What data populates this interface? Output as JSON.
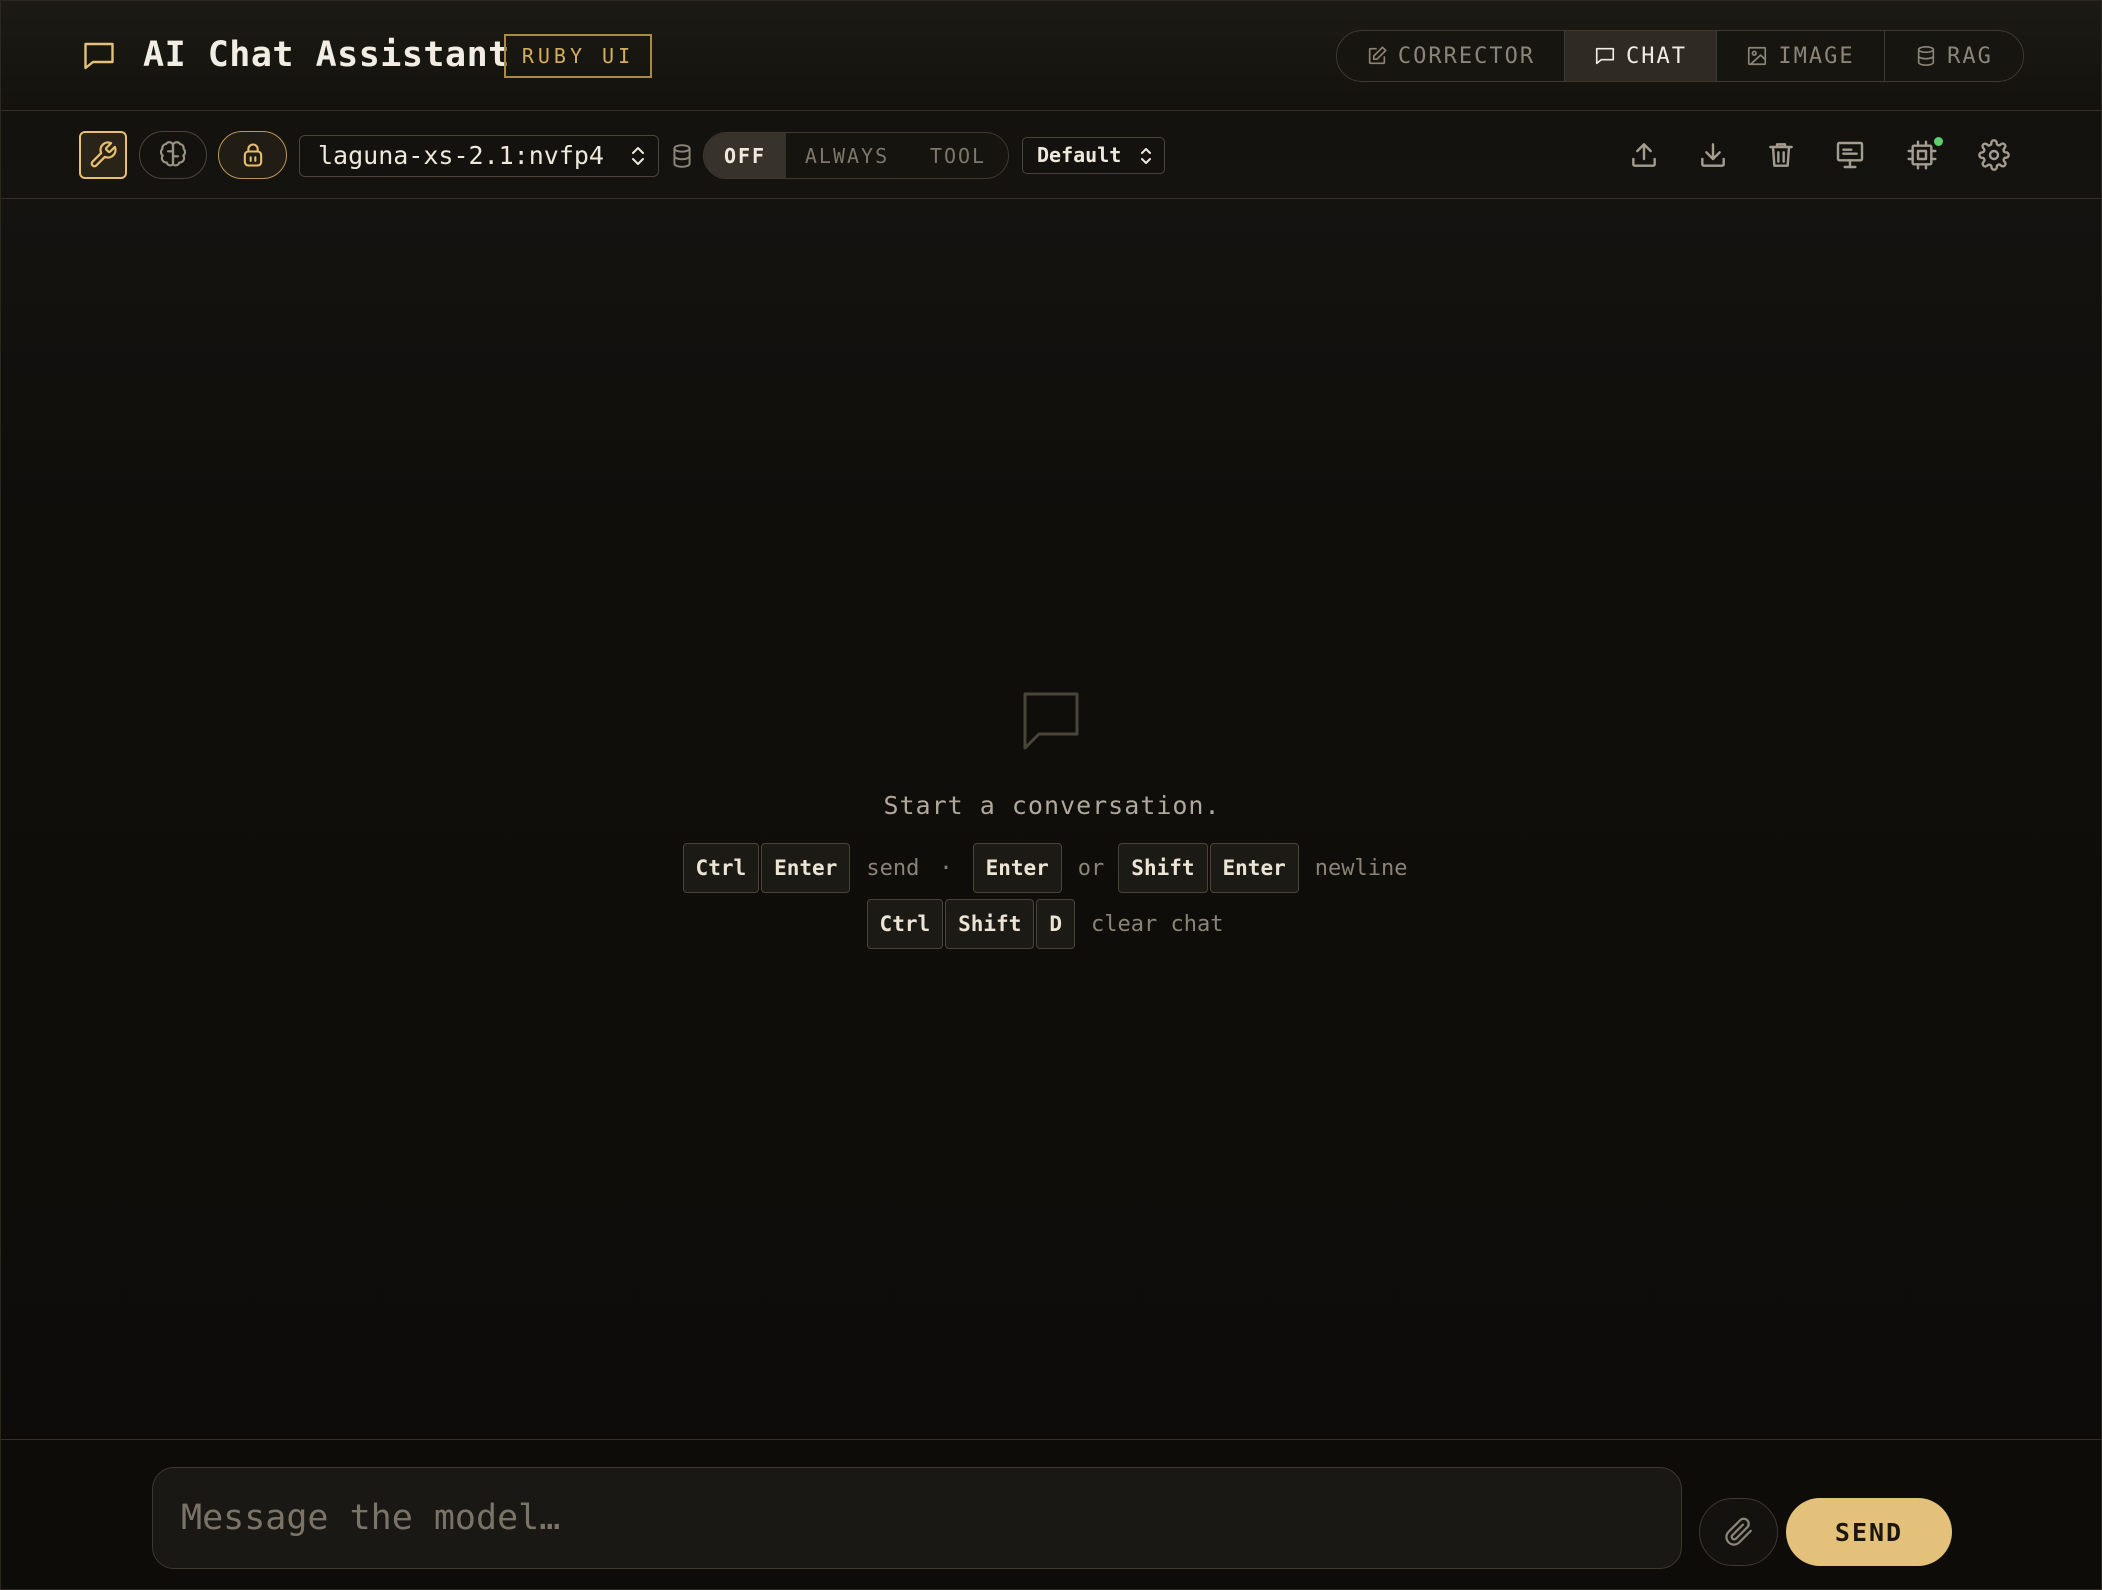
{
  "app": {
    "title": "AI Chat Assistant",
    "badge": "RUBY UI",
    "icon": "chat-bubble-icon"
  },
  "modes": [
    {
      "label": "CORRECTOR",
      "icon": "pencil-edit-icon",
      "active": false
    },
    {
      "label": "CHAT",
      "icon": "chat-bubble-icon",
      "active": true
    },
    {
      "label": "IMAGE",
      "icon": "image-icon",
      "active": false
    },
    {
      "label": "RAG",
      "icon": "database-icon",
      "active": false
    }
  ],
  "toolbar": {
    "toggles": [
      {
        "name": "tools",
        "icon": "wrench-icon",
        "active": true
      },
      {
        "name": "thinking",
        "icon": "brain-icon",
        "active": false
      },
      {
        "name": "private",
        "icon": "lock-icon",
        "active": true
      }
    ],
    "model": "laguna-xs-2.1:nvfp4",
    "rag_icon": "database-icon",
    "rag_options": [
      "OFF",
      "ALWAYS",
      "TOOL"
    ],
    "rag_selected": "OFF",
    "preset": "Default",
    "actions": [
      {
        "name": "export",
        "icon": "upload-icon"
      },
      {
        "name": "import",
        "icon": "download-icon"
      },
      {
        "name": "clear",
        "icon": "trash-icon"
      },
      {
        "name": "system-prompt",
        "icon": "monitor-icon"
      },
      {
        "name": "hardware-status",
        "icon": "cpu-chip-icon"
      },
      {
        "name": "settings",
        "icon": "gear-icon"
      }
    ]
  },
  "empty_state": {
    "icon": "chat-bubble-icon",
    "title": "Start a conversation.",
    "shortcuts": {
      "send_keys": [
        "Ctrl",
        "Enter"
      ],
      "send_label": "send",
      "separator": "·",
      "newline_key_a": "Enter",
      "or_label": "or",
      "newline_keys_b": [
        "Shift",
        "Enter"
      ],
      "newline_label": "newline",
      "clear_keys": [
        "Ctrl",
        "Shift",
        "D"
      ],
      "clear_label": "clear chat"
    }
  },
  "composer": {
    "placeholder": "Message the model…",
    "attach_icon": "paperclip-icon",
    "send_label": "SEND"
  },
  "colors": {
    "accent": "#e3c17a",
    "accent_border": "#a88a45",
    "background": "#0d0b08",
    "status_online": "#5fcf6e"
  }
}
